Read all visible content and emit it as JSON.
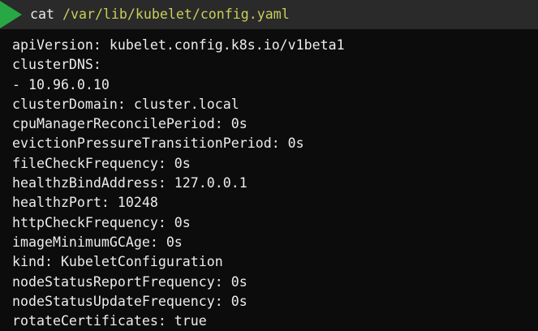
{
  "prompt": {
    "command": "cat",
    "path": "/var/lib/kubelet/config.yaml"
  },
  "output_lines": [
    "apiVersion: kubelet.config.k8s.io/v1beta1",
    "clusterDNS:",
    "- 10.96.0.10",
    "clusterDomain: cluster.local",
    "cpuManagerReconcilePeriod: 0s",
    "evictionPressureTransitionPeriod: 0s",
    "fileCheckFrequency: 0s",
    "healthzBindAddress: 127.0.0.1",
    "healthzPort: 10248",
    "httpCheckFrequency: 0s",
    "imageMinimumGCAge: 0s",
    "kind: KubeletConfiguration",
    "nodeStatusReportFrequency: 0s",
    "nodeStatusUpdateFrequency: 0s",
    "rotateCertificates: true"
  ],
  "colors": {
    "background": "#0c0c0c",
    "prompt_bar": "#2a2a2a",
    "prompt_arrow": "#27a845",
    "path": "#c8cf5a",
    "text": "#ececec"
  },
  "icons": {
    "prompt": "prompt-arrow-icon"
  }
}
